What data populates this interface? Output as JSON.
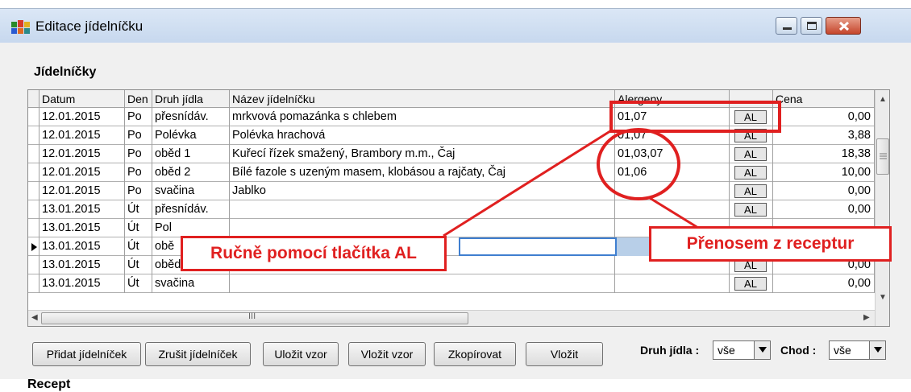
{
  "window": {
    "title": "Editace jídelníčku",
    "controls": {
      "minimize": "minimize",
      "maximize": "maximize",
      "close": "close"
    }
  },
  "section": {
    "title": "Jídelníčky"
  },
  "table": {
    "columns": {
      "datum": "Datum",
      "den": "Den",
      "druh": "Druh jídla",
      "nazev": "Název jídelníčku",
      "alergeny": "Alergeny",
      "cena": "Cena"
    },
    "rows": [
      {
        "datum": "12.01.2015",
        "den": "Po",
        "druh": "přesnídáv.",
        "nazev": "mrkvová pomazánka s chlebem",
        "alergeny": "01,07",
        "al": "AL",
        "cena": "0,00"
      },
      {
        "datum": "12.01.2015",
        "den": "Po",
        "druh": "Polévka",
        "nazev": "Polévka hrachová",
        "alergeny": "01,07",
        "al": "AL",
        "cena": "3,88"
      },
      {
        "datum": "12.01.2015",
        "den": "Po",
        "druh": "oběd 1",
        "nazev": "Kuřecí řízek smažený, Brambory m.m., Čaj",
        "alergeny": "01,03,07",
        "al": "AL",
        "cena": "18,38"
      },
      {
        "datum": "12.01.2015",
        "den": "Po",
        "druh": "oběd 2",
        "nazev": "Bílé fazole s uzeným masem, klobásou a rajčaty, Čaj",
        "alergeny": "01,06",
        "al": "AL",
        "cena": "10,00"
      },
      {
        "datum": "12.01.2015",
        "den": "Po",
        "druh": "svačina",
        "nazev": "Jablko",
        "alergeny": "",
        "al": "AL",
        "cena": "0,00"
      },
      {
        "datum": "13.01.2015",
        "den": "Út",
        "druh": "přesnídáv.",
        "nazev": "",
        "alergeny": "",
        "al": "AL",
        "cena": "0,00"
      },
      {
        "datum": "13.01.2015",
        "den": "Út",
        "druh": "Pol",
        "nazev": "",
        "alergeny": "",
        "al": "",
        "cena": ""
      },
      {
        "datum": "13.01.2015",
        "den": "Út",
        "druh": "obě",
        "nazev": "",
        "alergeny": "",
        "al": "",
        "cena": ""
      },
      {
        "datum": "13.01.2015",
        "den": "Út",
        "druh": "oběd 2",
        "nazev": "",
        "alergeny": "",
        "al": "AL",
        "cena": "0,00"
      },
      {
        "datum": "13.01.2015",
        "den": "Út",
        "druh": "svačina",
        "nazev": "",
        "alergeny": "",
        "al": "AL",
        "cena": "0,00"
      }
    ],
    "hscroll_grip": "III"
  },
  "callouts": {
    "manual": "Ručně pomocí tlačítka AL",
    "recipes": "Přenosem z receptur"
  },
  "buttons": {
    "add": "Přidat jídelníček",
    "cancel": "Zrušit jídelníček",
    "save_template": "Uložit vzor",
    "insert_template": "Vložit vzor",
    "copy": "Zkopírovat",
    "paste": "Vložit"
  },
  "filters": {
    "druh_label": "Druh jídla :",
    "druh_value": "vše",
    "chod_label": "Chod :",
    "chod_value": "vše"
  },
  "bottom": {
    "label": "Recept"
  },
  "colors": {
    "callout": "#e02020",
    "selection": "#b8cfe8",
    "titlebar": "#c7d8ee"
  }
}
